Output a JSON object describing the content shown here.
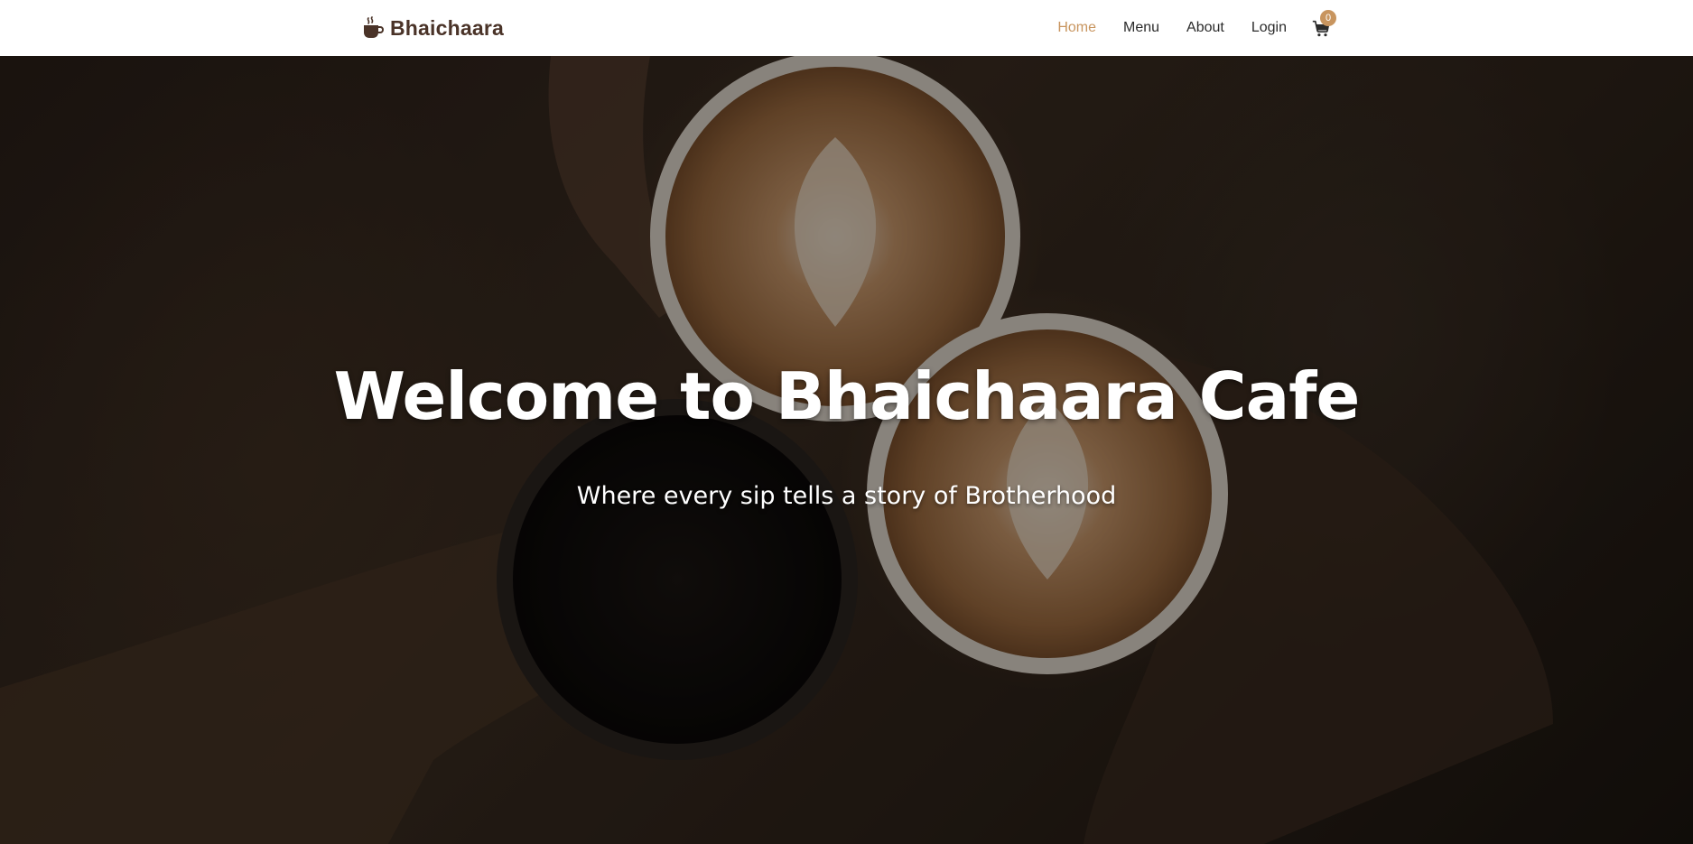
{
  "navbar": {
    "brand_name": "Bhaichaara",
    "brand_icon": "coffee-cup-icon",
    "links": [
      {
        "label": "Home",
        "active": true
      },
      {
        "label": "Menu",
        "active": false
      },
      {
        "label": "About",
        "active": false
      },
      {
        "label": "Login",
        "active": false
      }
    ],
    "cart": {
      "icon": "shopping-cart-icon",
      "count": "0"
    }
  },
  "hero": {
    "title": "Welcome to Bhaichaara Cafe",
    "subtitle": "Where every sip tells a story of Brotherhood",
    "background_image": "people-holding-coffee-cups-photo"
  },
  "colors": {
    "brand": "#4a3328",
    "accent": "#c8955f",
    "nav_bg": "#ffffff",
    "hero_text": "#ffffff"
  }
}
